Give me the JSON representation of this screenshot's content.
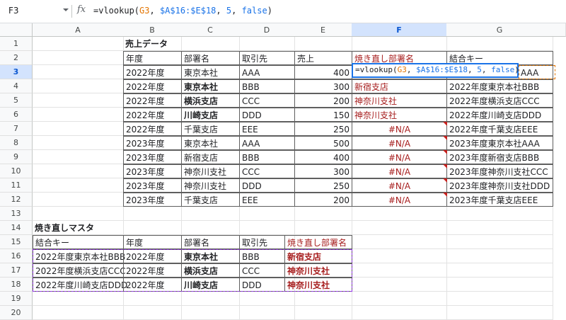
{
  "formula_bar": {
    "cell_ref": "F3",
    "fx_label": "fx",
    "tokens": [
      {
        "text": "=vlookup(",
        "kind": "fn"
      },
      {
        "text": "G3",
        "kind": "ref1"
      },
      {
        "text": ", ",
        "kind": "fn"
      },
      {
        "text": "$A$16:$E$18",
        "kind": "ref2"
      },
      {
        "text": ", ",
        "kind": "fn"
      },
      {
        "text": "5",
        "kind": "num"
      },
      {
        "text": ", ",
        "kind": "fn"
      },
      {
        "text": "false",
        "kind": "bool"
      },
      {
        "text": ")",
        "kind": "fn"
      }
    ]
  },
  "columns": [
    "A",
    "B",
    "C",
    "D",
    "E",
    "F",
    "G"
  ],
  "rows": [
    "1",
    "2",
    "3",
    "4",
    "5",
    "6",
    "7",
    "8",
    "9",
    "10",
    "11",
    "12",
    "13",
    "14",
    "15",
    "16",
    "17",
    "18",
    "19",
    "20"
  ],
  "selected_col": "F",
  "selected_row": "3",
  "sales": {
    "title": "売上データ",
    "headers": [
      "年度",
      "部署名",
      "取引先",
      "売上",
      "焼き直し部署名",
      "結合キー"
    ],
    "rows": [
      {
        "year": "2022年度",
        "dept": "東京本社",
        "client": "AAA",
        "sales": "400",
        "redo": "",
        "key": "AAA",
        "dept_bold": false,
        "redo_style": "active"
      },
      {
        "year": "2022年度",
        "dept": "東京本社",
        "client": "BBB",
        "sales": "300",
        "redo": "新宿支店",
        "key": "2022年度東京本社BBB",
        "dept_bold": true,
        "redo_style": "red"
      },
      {
        "year": "2022年度",
        "dept": "横浜支店",
        "client": "CCC",
        "sales": "200",
        "redo": "神奈川支社",
        "key": "2022年度横浜支店CCC",
        "dept_bold": true,
        "redo_style": "red"
      },
      {
        "year": "2022年度",
        "dept": "川崎支店",
        "client": "DDD",
        "sales": "150",
        "redo": "神奈川支社",
        "key": "2022年度川崎支店DDD",
        "dept_bold": true,
        "redo_style": "red"
      },
      {
        "year": "2022年度",
        "dept": "千葉支店",
        "client": "EEE",
        "sales": "250",
        "redo": "#N/A",
        "key": "2022年度千葉支店EEE",
        "dept_bold": false,
        "redo_style": "na"
      },
      {
        "year": "2023年度",
        "dept": "東京本社",
        "client": "AAA",
        "sales": "500",
        "redo": "#N/A",
        "key": "2023年度東京本社AAA",
        "dept_bold": false,
        "redo_style": "na"
      },
      {
        "year": "2023年度",
        "dept": "新宿支店",
        "client": "BBB",
        "sales": "400",
        "redo": "#N/A",
        "key": "2023年度新宿支店BBB",
        "dept_bold": false,
        "redo_style": "na"
      },
      {
        "year": "2023年度",
        "dept": "神奈川支社",
        "client": "CCC",
        "sales": "300",
        "redo": "#N/A",
        "key": "2023年度神奈川支社CCC",
        "dept_bold": false,
        "redo_style": "na"
      },
      {
        "year": "2023年度",
        "dept": "神奈川支社",
        "client": "DDD",
        "sales": "250",
        "redo": "#N/A",
        "key": "2023年度神奈川支社DDD",
        "dept_bold": false,
        "redo_style": "na"
      },
      {
        "year": "2023年度",
        "dept": "千葉支店",
        "client": "EEE",
        "sales": "200",
        "redo": "#N/A",
        "key": "2023年度千葉支店EEE",
        "dept_bold": false,
        "redo_style": "na"
      }
    ]
  },
  "master": {
    "title": "焼き直しマスタ",
    "headers": [
      "結合キー",
      "年度",
      "部署名",
      "取引先",
      "焼き直し部署名"
    ],
    "rows": [
      {
        "key": "2022年度東京本社BBB",
        "year": "2022年度",
        "dept": "東京本社",
        "client": "BBB",
        "redo": "新宿支店"
      },
      {
        "key": "2022年度横浜支店CCC",
        "year": "2022年度",
        "dept": "横浜支店",
        "client": "CCC",
        "redo": "神奈川支社"
      },
      {
        "key": "2022年度川崎支店DDD",
        "year": "2022年度",
        "dept": "川崎支店",
        "client": "DDD",
        "redo": "神奈川支社"
      }
    ]
  },
  "colors": {
    "accent": "#1a73e8",
    "ref_orange": "#e37400",
    "error_red": "#a61c1c",
    "master_dash": "#9334e6"
  }
}
